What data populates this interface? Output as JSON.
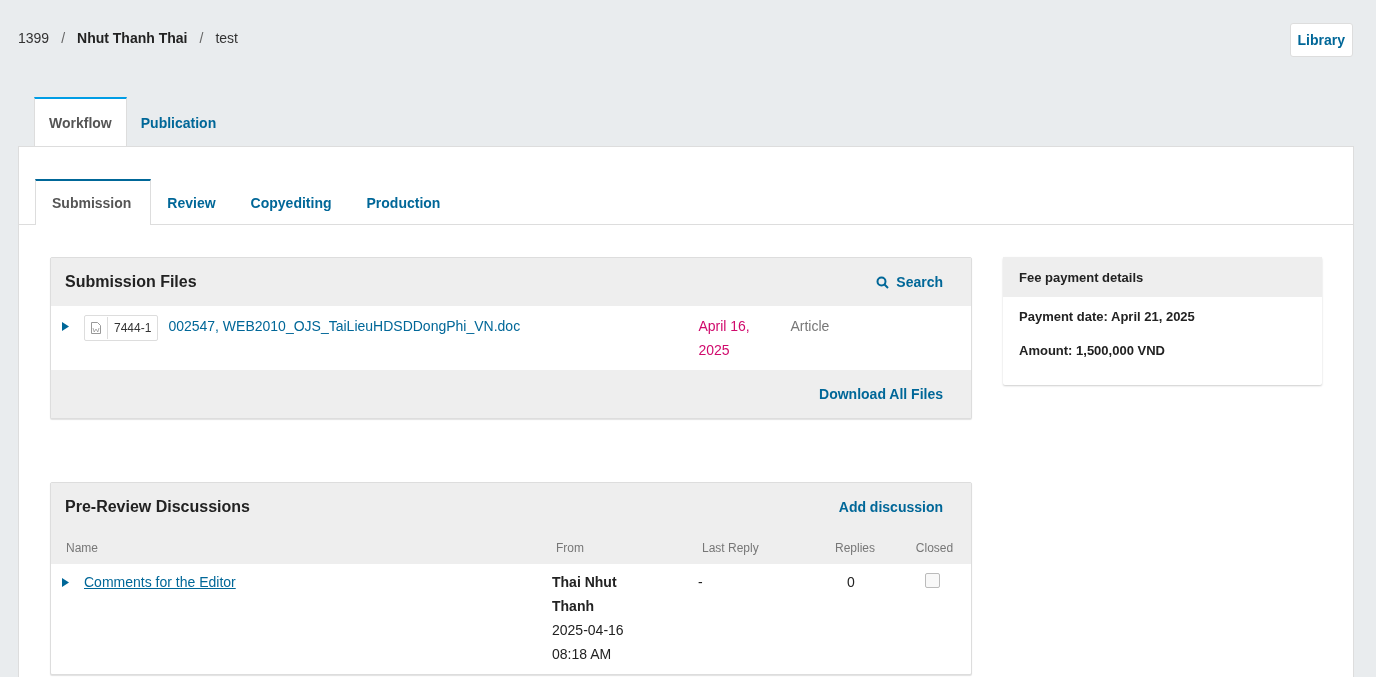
{
  "breadcrumb": [
    {
      "text": "1399",
      "bold": false
    },
    {
      "separator": "/",
      "text": "Nhut Thanh Thai",
      "bold": true
    },
    {
      "separator": "/",
      "text": "test",
      "bold": false
    }
  ],
  "library_button": "Library",
  "tabs": [
    {
      "label": "Workflow",
      "selected": true
    },
    {
      "label": "Publication",
      "selected": false
    }
  ],
  "stage_tabs": [
    {
      "label": "Submission",
      "selected": true
    },
    {
      "label": "Review",
      "selected": false
    },
    {
      "label": "Copyediting",
      "selected": false
    },
    {
      "label": "Production",
      "selected": false
    }
  ],
  "submission_files": {
    "title": "Submission Files",
    "search": "Search",
    "rows": [
      {
        "expanded": false,
        "file_id": "7444-1",
        "name": "002547, WEB2010_OJS_TaiLieuHDSDDongPhi_VN.doc",
        "date": "April 16, 2025",
        "type": "Article"
      }
    ],
    "download_all": "Download All Files"
  },
  "discussions": {
    "title": "Pre-Review Discussions",
    "add": "Add discussion",
    "columns": [
      "Name",
      "From",
      "Last Reply",
      "Replies",
      "Closed"
    ],
    "rows": [
      {
        "expanded": false,
        "name": "Comments for the Editor",
        "from_name": "Thai Nhut Thanh",
        "from_date": "2025-04-16 08:18 AM",
        "last_reply": "-",
        "replies": "0",
        "closed": false
      }
    ]
  },
  "fee": {
    "title": "Fee payment details",
    "lines": [
      "Payment date: April 21, 2025",
      "Amount: 1,500,000 VND"
    ]
  }
}
